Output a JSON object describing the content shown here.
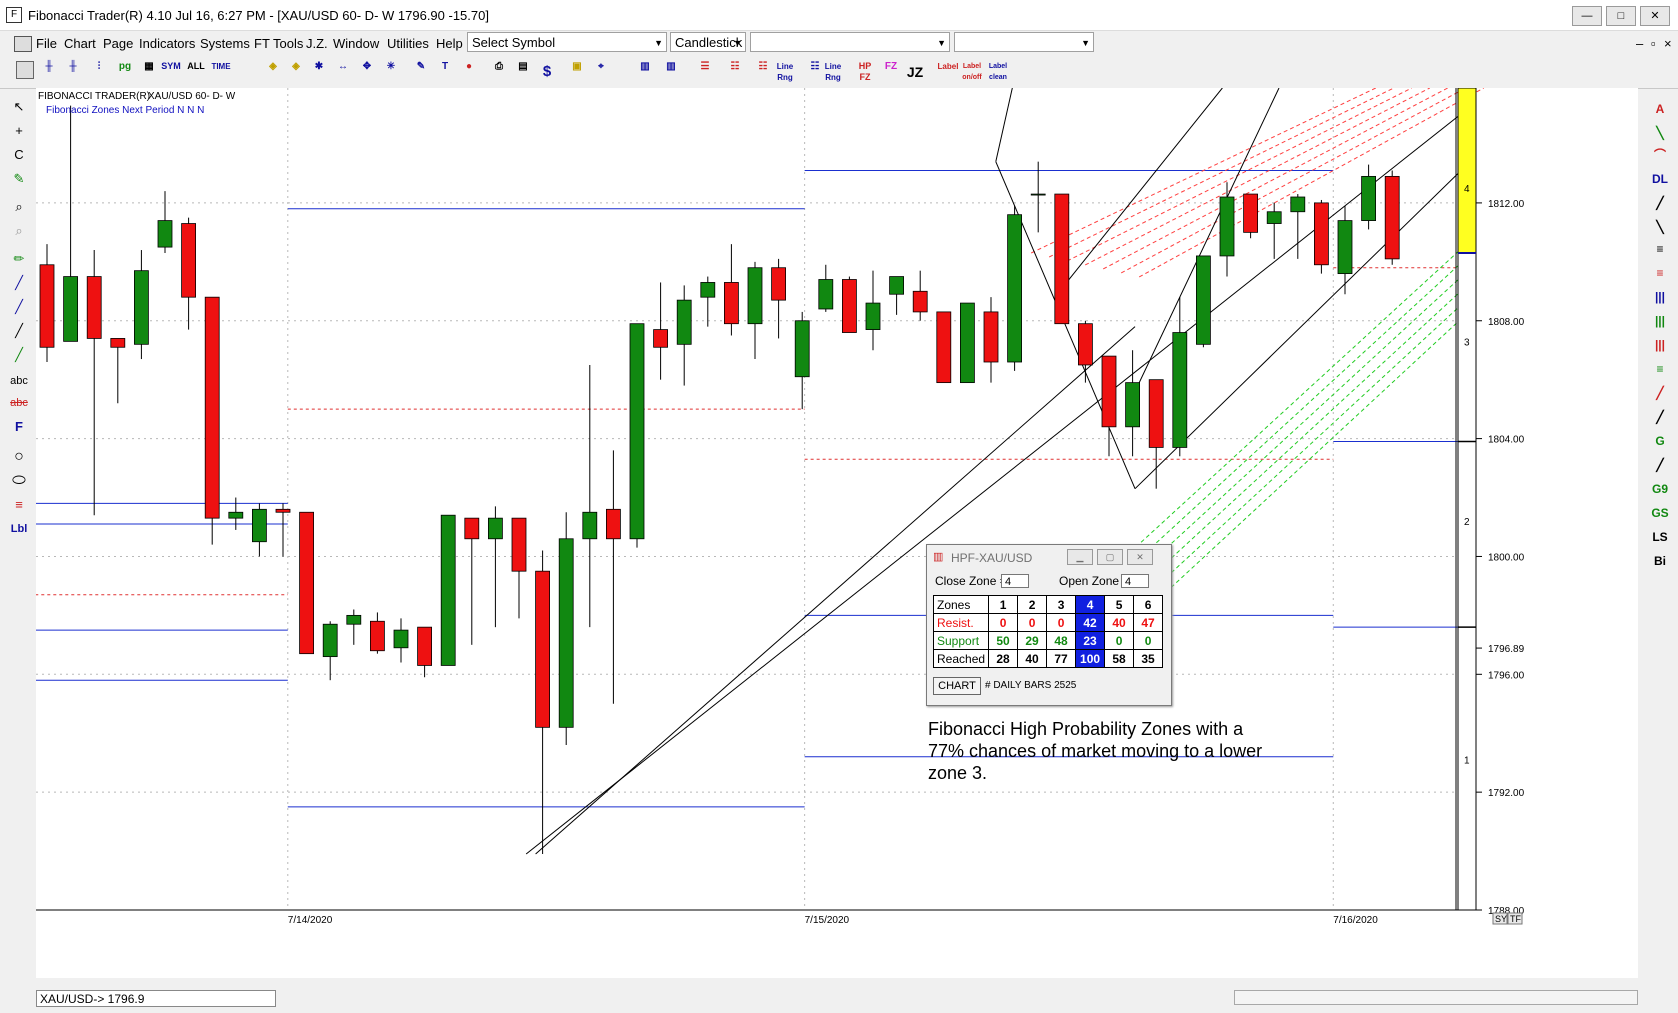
{
  "window": {
    "title": "Fibonacci Trader(R) 4.10 Jul 16,  6:27 PM - [XAU/USD 60- D- W  1796.90  -15.70]",
    "buttons": [
      "—",
      "□",
      "✕"
    ]
  },
  "menu": {
    "items": [
      "File",
      "Chart",
      "Page",
      "Indicators",
      "Systems",
      "FT Tools",
      "J.Z.",
      "Window",
      "Utilities",
      "Help"
    ],
    "symbol_combo": "Select Symbol",
    "style_combo": "Candlestick",
    "mdi_buttons": [
      "–",
      "▫",
      "×"
    ]
  },
  "toolbar": {
    "labels": [
      "SYM",
      "ALL",
      "TIME",
      "Line Rng",
      "Line Rng",
      "HP FZ",
      "FZ",
      "JZ",
      "Label",
      "Label on/off",
      "Label clean"
    ]
  },
  "left_tools": [
    "↖",
    "+",
    "C",
    "✎",
    "⌕",
    "⌕",
    "✏",
    "╱",
    "╱",
    "╱",
    "╱",
    "abc",
    "abc",
    "F",
    "○",
    "⬭",
    "≡",
    "Lbl"
  ],
  "right_tools": [
    "A",
    "╲",
    "⌒",
    "DL",
    "╱",
    "╲",
    "≡",
    "≡",
    "|||",
    "|||",
    "|||",
    "≡",
    "╱",
    "╱",
    "G",
    "╱",
    "G9",
    "GS",
    "LS",
    "Bi"
  ],
  "chart": {
    "header_left": "FIBONACCI TRADER(R)",
    "header_symbol": "XAU/USD 60- D- W",
    "subtitle": "Fibonacci Zones Next Period N N N",
    "colors": {
      "up": "#118811",
      "down": "#ee1111",
      "zone_line": "#1a2fcf",
      "zone_dash": "#e03030",
      "fan_red": "#ff4040",
      "fan_green": "#22cc22",
      "zone_bar": "#ffff20"
    },
    "right_zone_numbers": [
      "4",
      "3",
      "2",
      "1"
    ],
    "side_buttons": [
      "SY",
      "TF"
    ]
  },
  "chart_data": {
    "type": "candlestick",
    "symbol": "XAU/USD",
    "timeframe": "60",
    "x_labels": [
      "7/14/2020",
      "7/15/2020",
      "7/16/2020"
    ],
    "y_ticks": [
      1788.0,
      1792.0,
      1796.0,
      1800.0,
      1804.0,
      1808.0,
      1812.0
    ],
    "current_price": 1796.89,
    "ylim": [
      1788.0,
      1815.9
    ],
    "grid": true,
    "candles": [
      [
        1809.9,
        1810.6,
        1806.6,
        1807.1
      ],
      [
        1807.3,
        1815.3,
        1807.3,
        1809.5
      ],
      [
        1809.5,
        1810.4,
        1801.4,
        1807.4
      ],
      [
        1807.4,
        1807.4,
        1805.2,
        1807.1
      ],
      [
        1807.2,
        1810.4,
        1806.7,
        1809.7
      ],
      [
        1810.5,
        1812.4,
        1810.3,
        1811.4
      ],
      [
        1811.3,
        1811.5,
        1807.7,
        1808.8
      ],
      [
        1808.8,
        1808.8,
        1800.4,
        1801.3
      ],
      [
        1801.3,
        1802.0,
        1800.9,
        1801.5
      ],
      [
        1800.5,
        1801.8,
        1800.0,
        1801.6
      ],
      [
        1801.6,
        1801.8,
        1800.0,
        1801.5
      ],
      [
        1801.5,
        1801.5,
        1796.7,
        1796.7
      ],
      [
        1796.6,
        1797.8,
        1795.8,
        1797.7
      ],
      [
        1797.7,
        1798.2,
        1797.0,
        1798.0
      ],
      [
        1797.8,
        1798.1,
        1796.7,
        1796.8
      ],
      [
        1796.9,
        1797.9,
        1796.4,
        1797.5
      ],
      [
        1797.6,
        1797.6,
        1795.9,
        1796.3
      ],
      [
        1796.3,
        1801.4,
        1796.3,
        1801.4
      ],
      [
        1801.3,
        1801.3,
        1797.0,
        1800.6
      ],
      [
        1800.6,
        1801.7,
        1797.6,
        1801.3
      ],
      [
        1801.3,
        1801.3,
        1797.9,
        1799.5
      ],
      [
        1799.5,
        1800.2,
        1789.9,
        1794.2
      ],
      [
        1794.2,
        1801.5,
        1793.6,
        1800.6
      ],
      [
        1800.6,
        1806.5,
        1797.6,
        1801.5
      ],
      [
        1801.6,
        1803.6,
        1795.0,
        1800.6
      ],
      [
        1800.6,
        1807.9,
        1800.3,
        1807.9
      ],
      [
        1807.7,
        1809.3,
        1806.0,
        1807.1
      ],
      [
        1807.2,
        1809.2,
        1805.8,
        1808.7
      ],
      [
        1808.8,
        1809.5,
        1807.8,
        1809.3
      ],
      [
        1809.3,
        1810.6,
        1807.5,
        1807.9
      ],
      [
        1807.9,
        1810.0,
        1806.7,
        1809.8
      ],
      [
        1809.8,
        1810.1,
        1807.4,
        1808.7
      ],
      [
        1806.1,
        1808.3,
        1805.0,
        1808.0
      ],
      [
        1808.4,
        1809.9,
        1808.3,
        1809.4
      ],
      [
        1809.4,
        1809.5,
        1808.0,
        1807.6
      ],
      [
        1807.7,
        1809.7,
        1807.0,
        1808.6
      ],
      [
        1808.9,
        1809.3,
        1808.2,
        1809.5
      ],
      [
        1809.0,
        1809.7,
        1808.0,
        1808.3
      ],
      [
        1808.3,
        1808.3,
        1805.9,
        1805.9
      ],
      [
        1805.9,
        1808.6,
        1805.9,
        1808.6
      ],
      [
        1808.3,
        1808.8,
        1805.9,
        1806.6
      ],
      [
        1806.6,
        1811.9,
        1806.3,
        1811.6
      ],
      [
        1812.3,
        1813.4,
        1811.0,
        1812.3
      ],
      [
        1812.3,
        1812.3,
        1807.9,
        1807.9
      ],
      [
        1807.9,
        1808.0,
        1805.9,
        1806.5
      ],
      [
        1806.8,
        1806.8,
        1803.4,
        1804.4
      ],
      [
        1804.4,
        1807.0,
        1803.4,
        1805.9
      ],
      [
        1806.0,
        1806.0,
        1802.3,
        1803.7
      ],
      [
        1803.7,
        1808.8,
        1803.4,
        1807.6
      ],
      [
        1807.2,
        1809.7,
        1807.1,
        1810.2
      ],
      [
        1810.2,
        1812.7,
        1809.5,
        1812.2
      ],
      [
        1812.3,
        1812.3,
        1810.8,
        1811.0
      ],
      [
        1811.3,
        1812.0,
        1810.1,
        1811.7
      ],
      [
        1811.7,
        1812.3,
        1810.1,
        1812.2
      ],
      [
        1812.0,
        1812.1,
        1809.6,
        1809.9
      ],
      [
        1809.6,
        1811.9,
        1808.9,
        1811.4
      ],
      [
        1811.4,
        1813.3,
        1811.1,
        1812.9
      ],
      [
        1812.9,
        1813.1,
        1809.9,
        1810.1
      ]
    ]
  },
  "hpf_window": {
    "title": "HPF-XAU/USD",
    "close_zone_label": "Close Zone =",
    "close_zone_value": "4",
    "open_zone_label": "Open Zone =",
    "open_zone_value": "4",
    "header": [
      "Zones",
      "1",
      "2",
      "3",
      "4",
      "5",
      "6"
    ],
    "rows": [
      {
        "label": "Resist.",
        "values": [
          "0",
          "0",
          "0",
          "42",
          "40",
          "47"
        ]
      },
      {
        "label": "Support",
        "values": [
          "50",
          "29",
          "48",
          "23",
          "0",
          "0"
        ]
      },
      {
        "label": "Reached",
        "values": [
          "28",
          "40",
          "77",
          "100",
          "58",
          "35"
        ]
      }
    ],
    "chart_button": "CHART",
    "bars_label": "# DAILY BARS 2525"
  },
  "annotation": "Fibonacci High Probability Zones with a 77% chances of market moving to a lower zone 3.",
  "status": {
    "field": "XAU/USD->  1796.9"
  }
}
